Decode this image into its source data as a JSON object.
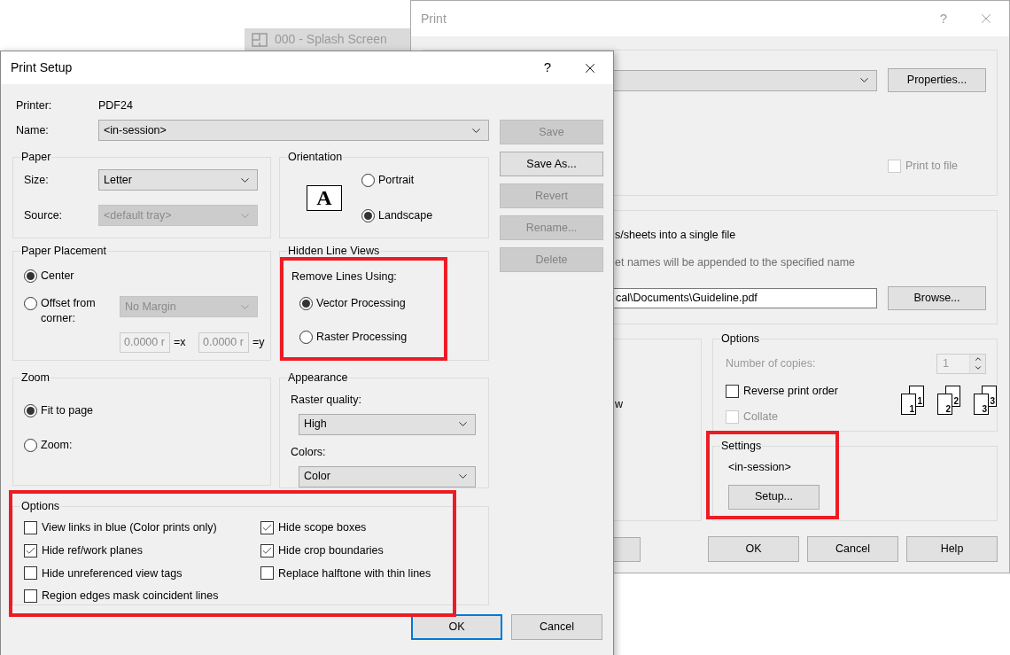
{
  "background_tab": {
    "label": "000 - Splash Screen"
  },
  "print_window": {
    "title": "Print",
    "help": "?",
    "properties": "Properties...",
    "print_to_file": {
      "label": "Print to file",
      "checked": false
    },
    "combine_text": "s/sheets into a single file",
    "combine_hint": "et names will be appended to the specified name",
    "file_path": "cal\\Documents\\Guideline.pdf",
    "browse": "Browse...",
    "cut_text": "w",
    "options": {
      "label": "Options",
      "copies_label": "Number of copies:",
      "copies": "1",
      "reverse": {
        "label": "Reverse print order",
        "checked": false,
        "disabled": false
      },
      "collate": {
        "label": "Collate",
        "checked": false,
        "disabled": true
      },
      "collate_pages": [
        {
          "front": "1",
          "back": "1"
        },
        {
          "front": "2",
          "back": "2"
        },
        {
          "front": "3",
          "back": "3"
        }
      ]
    },
    "settings": {
      "label": "Settings",
      "name": "<in-session>",
      "setup": "Setup..."
    },
    "buttons": [
      {
        "label": "OK"
      },
      {
        "label": "Cancel"
      },
      {
        "label": "Help"
      }
    ]
  },
  "print_setup": {
    "title": "Print Setup",
    "help": "?",
    "printer_label": "Printer:",
    "printer": "PDF24",
    "name_label": "Name:",
    "name": "<in-session>",
    "side_buttons": [
      {
        "label": "Save",
        "disabled": true
      },
      {
        "label": "Save As...",
        "disabled": false
      },
      {
        "label": "Revert",
        "disabled": true
      },
      {
        "label": "Rename...",
        "disabled": true
      },
      {
        "label": "Delete",
        "disabled": true
      }
    ],
    "paper": {
      "label": "Paper",
      "size_label": "Size:",
      "size": "Letter",
      "source_label": "Source:",
      "source": "<default tray>",
      "source_disabled": true
    },
    "orientation": {
      "label": "Orientation",
      "icon_letter": "A",
      "options": [
        {
          "label": "Portrait",
          "selected": false
        },
        {
          "label": "Landscape",
          "selected": true
        }
      ]
    },
    "placement": {
      "label": "Paper Placement",
      "options": [
        {
          "label": "Center",
          "selected": true
        },
        {
          "label": "Offset from corner:",
          "selected": false
        }
      ],
      "margin": "No Margin",
      "x": "0.0000 r",
      "x_suffix": "=x",
      "y": "0.0000 r",
      "y_suffix": "=y"
    },
    "hidden_lines": {
      "label": "Hidden Line Views",
      "sublabel": "Remove Lines Using:",
      "options": [
        {
          "label": "Vector Processing",
          "selected": true
        },
        {
          "label": "Raster Processing",
          "selected": false
        }
      ]
    },
    "zoom": {
      "label": "Zoom",
      "options": [
        {
          "label": "Fit to page",
          "selected": true
        },
        {
          "label": "Zoom:",
          "selected": false
        }
      ]
    },
    "appearance": {
      "label": "Appearance",
      "quality_label": "Raster quality:",
      "quality": "High",
      "colors_label": "Colors:",
      "colors": "Color"
    },
    "options": {
      "label": "Options",
      "left": [
        {
          "label": "View links in blue (Color prints only)",
          "checked": false
        },
        {
          "label": "Hide ref/work planes",
          "checked": true
        },
        {
          "label": "Hide unreferenced view tags",
          "checked": false
        },
        {
          "label": "Region edges mask coincident lines",
          "checked": false
        }
      ],
      "right": [
        {
          "label": "Hide scope boxes",
          "checked": true
        },
        {
          "label": "Hide crop boundaries",
          "checked": true
        },
        {
          "label": "Replace halftone with thin lines",
          "checked": false
        }
      ]
    },
    "buttons": [
      {
        "label": "OK",
        "default": true
      },
      {
        "label": "Cancel",
        "default": false
      }
    ]
  }
}
